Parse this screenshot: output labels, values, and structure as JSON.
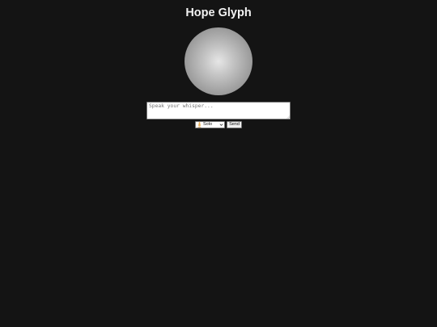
{
  "app": {
    "title": "Hope Glyph"
  },
  "whisper": {
    "placeholder": "Speak your whisper...",
    "value": ""
  },
  "mode_select": {
    "icon": "person-meditating-icon",
    "selected": "Solo"
  },
  "send_button": {
    "label": "Send"
  },
  "colors": {
    "background": "#141414",
    "title": "#f2f2f2",
    "orb_center": "#e6e6e6",
    "orb_edge": "#7d7d7d",
    "icon_accent": "#e8a33d"
  }
}
